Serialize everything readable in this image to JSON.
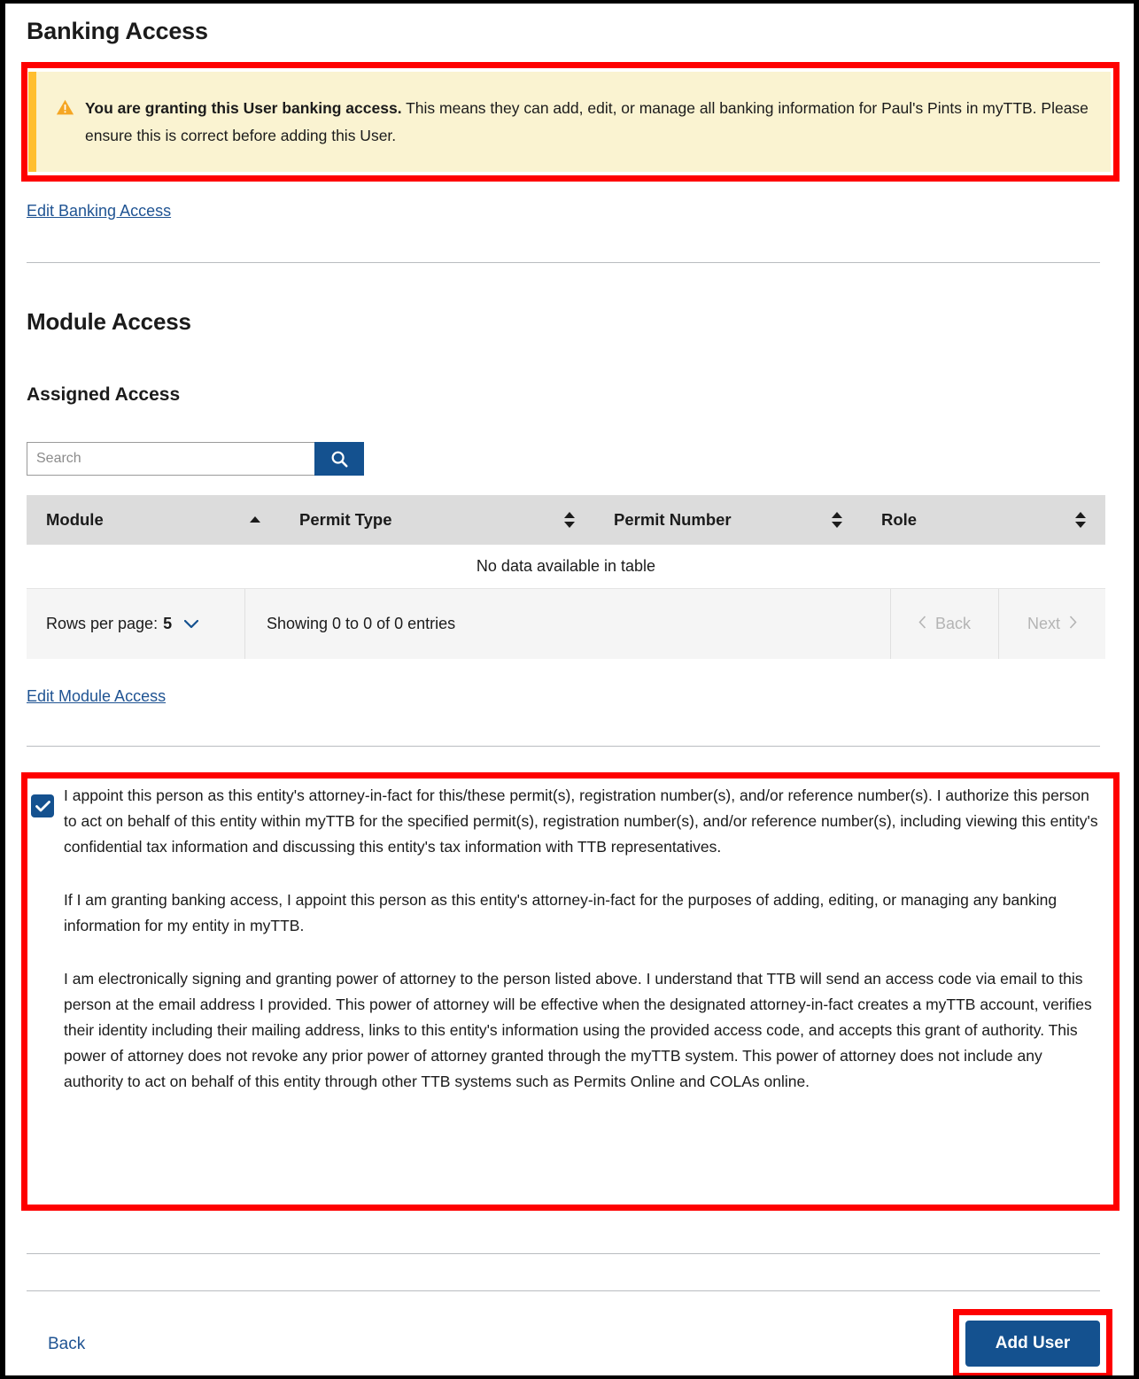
{
  "banking": {
    "heading": "Banking Access",
    "alert": {
      "icon": "warning-triangle-icon",
      "bold_text": "You are granting this User banking access.",
      "rest_text": " This means they can add, edit, or manage all banking information for Paul's Pints in myTTB. Please ensure this is correct before adding this User.",
      "background_color": "#faf3d1",
      "accent_color": "#ffbe2e"
    },
    "edit_link": "Edit Banking Access"
  },
  "module": {
    "heading": "Module Access",
    "subheading": "Assigned Access",
    "search": {
      "placeholder": "Search",
      "value": "",
      "icon": "search-icon",
      "button_color": "#14518f"
    },
    "table": {
      "columns": [
        {
          "label": "Module",
          "sort": "asc"
        },
        {
          "label": "Permit Type",
          "sort": "none"
        },
        {
          "label": "Permit Number",
          "sort": "none"
        },
        {
          "label": "Role",
          "sort": "none"
        }
      ],
      "empty_message": "No data available in table",
      "rows": []
    },
    "pagination": {
      "rows_per_page_label": "Rows per page:",
      "rows_per_page_value": "5",
      "showing_text": "Showing 0 to 0 of 0 entries",
      "back_label": "Back",
      "next_label": "Next",
      "back_enabled": false,
      "next_enabled": false
    },
    "edit_link": "Edit Module Access"
  },
  "poa": {
    "checkbox_checked": true,
    "paragraphs": [
      "I appoint this person as this entity's attorney-in-fact for this/these permit(s), registration number(s), and/or reference number(s). I authorize this person to act on behalf of this entity within myTTB for the specified permit(s), registration number(s), and/or reference number(s), including viewing this entity's confidential tax information and discussing this entity's tax information with TTB representatives.",
      "If I am granting banking access, I appoint this person as this entity's attorney-in-fact for the purposes of adding, editing, or managing any banking information for my entity in myTTB.",
      "I am electronically signing and granting power of attorney to the person listed above. I understand that TTB will send an access code via email to this person at the email address I provided. This power of attorney will be effective when the designated attorney-in-fact creates a myTTB account, verifies their identity including their mailing address, links to this entity's information using the provided access code, and accepts this grant of authority. This power of attorney does not revoke any prior power of attorney granted through the myTTB system. This power of attorney does not include any authority to act on behalf of this entity through other TTB systems such as Permits Online and COLAs online."
    ]
  },
  "footer": {
    "back_label": "Back",
    "submit_label": "Add User",
    "submit_color": "#14518f"
  },
  "annotations": {
    "highlight_color": "#fe0000",
    "boxes": [
      "banking-alert-highlight",
      "poa-highlight",
      "add-user-highlight"
    ]
  }
}
